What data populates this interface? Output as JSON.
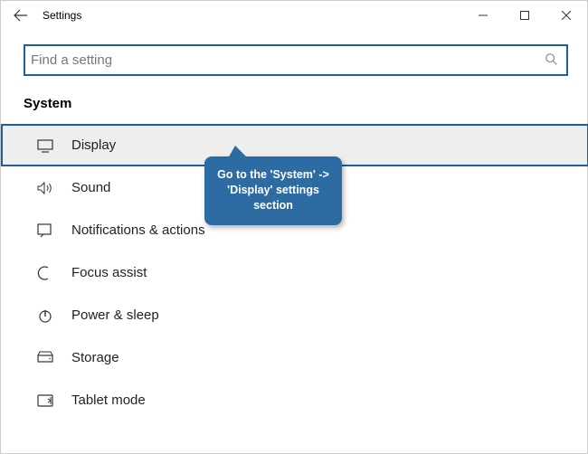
{
  "window": {
    "title": "Settings"
  },
  "search": {
    "placeholder": "Find a setting"
  },
  "heading": "System",
  "items": [
    {
      "label": "Display"
    },
    {
      "label": "Sound"
    },
    {
      "label": "Notifications & actions"
    },
    {
      "label": "Focus assist"
    },
    {
      "label": "Power & sleep"
    },
    {
      "label": "Storage"
    },
    {
      "label": "Tablet mode"
    }
  ],
  "tooltip": "Go to the 'System' -> 'Display' settings section"
}
